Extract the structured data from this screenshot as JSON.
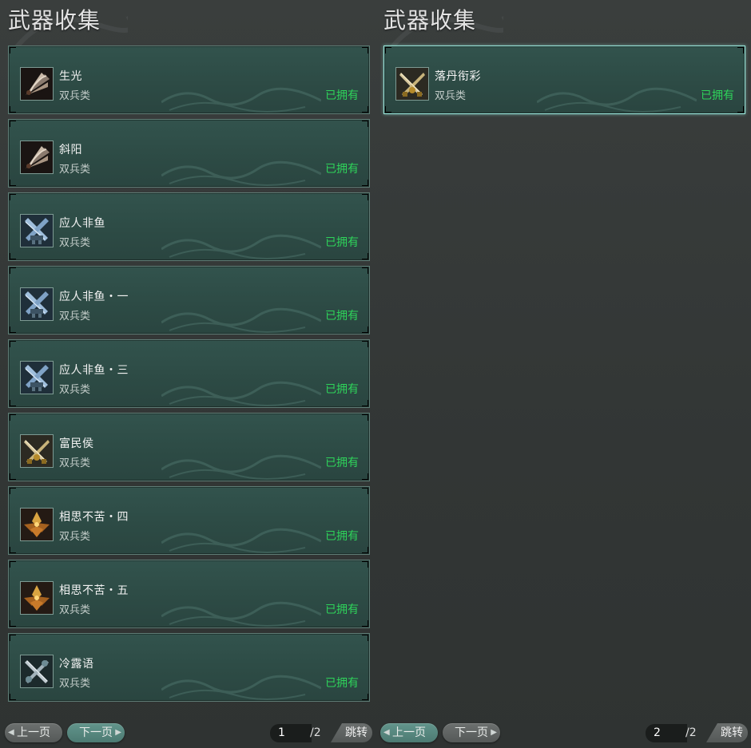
{
  "panels": [
    {
      "title": "武器收集",
      "items": [
        {
          "name": "生光",
          "type": "双兵类",
          "status": "已拥有",
          "icon": "fan-blade-icon"
        },
        {
          "name": "斜阳",
          "type": "双兵类",
          "status": "已拥有",
          "icon": "fan-blade-icon"
        },
        {
          "name": "应人非鱼",
          "type": "双兵类",
          "status": "已拥有",
          "icon": "crossed-blades-icon"
        },
        {
          "name": "应人非鱼・一",
          "type": "双兵类",
          "status": "已拥有",
          "icon": "crossed-blades-icon"
        },
        {
          "name": "应人非鱼・三",
          "type": "双兵类",
          "status": "已拥有",
          "icon": "crossed-blades-icon"
        },
        {
          "name": "富民侯",
          "type": "双兵类",
          "status": "已拥有",
          "icon": "golden-swords-icon"
        },
        {
          "name": "相思不苦・四",
          "type": "双兵类",
          "status": "已拥有",
          "icon": "flame-axes-icon"
        },
        {
          "name": "相思不苦・五",
          "type": "双兵类",
          "status": "已拥有",
          "icon": "flame-axes-icon"
        },
        {
          "name": "冷露语",
          "type": "双兵类",
          "status": "已拥有",
          "icon": "silver-blades-icon"
        }
      ],
      "pager": {
        "prev": "上一页",
        "next": "下一页",
        "current": "1",
        "total": "/2",
        "jump": "跳转"
      }
    },
    {
      "title": "武器收集",
      "items": [
        {
          "name": "落丹衔彩",
          "type": "双兵类",
          "status": "已拥有",
          "icon": "golden-swords-icon"
        }
      ],
      "pager": {
        "prev": "上一页",
        "next": "下一页",
        "current": "2",
        "total": "/2",
        "jump": "跳转"
      }
    }
  ],
  "colors": {
    "owned": "#2ed35a",
    "card": "#2d4b45",
    "selected_border": "#9be8dc"
  }
}
